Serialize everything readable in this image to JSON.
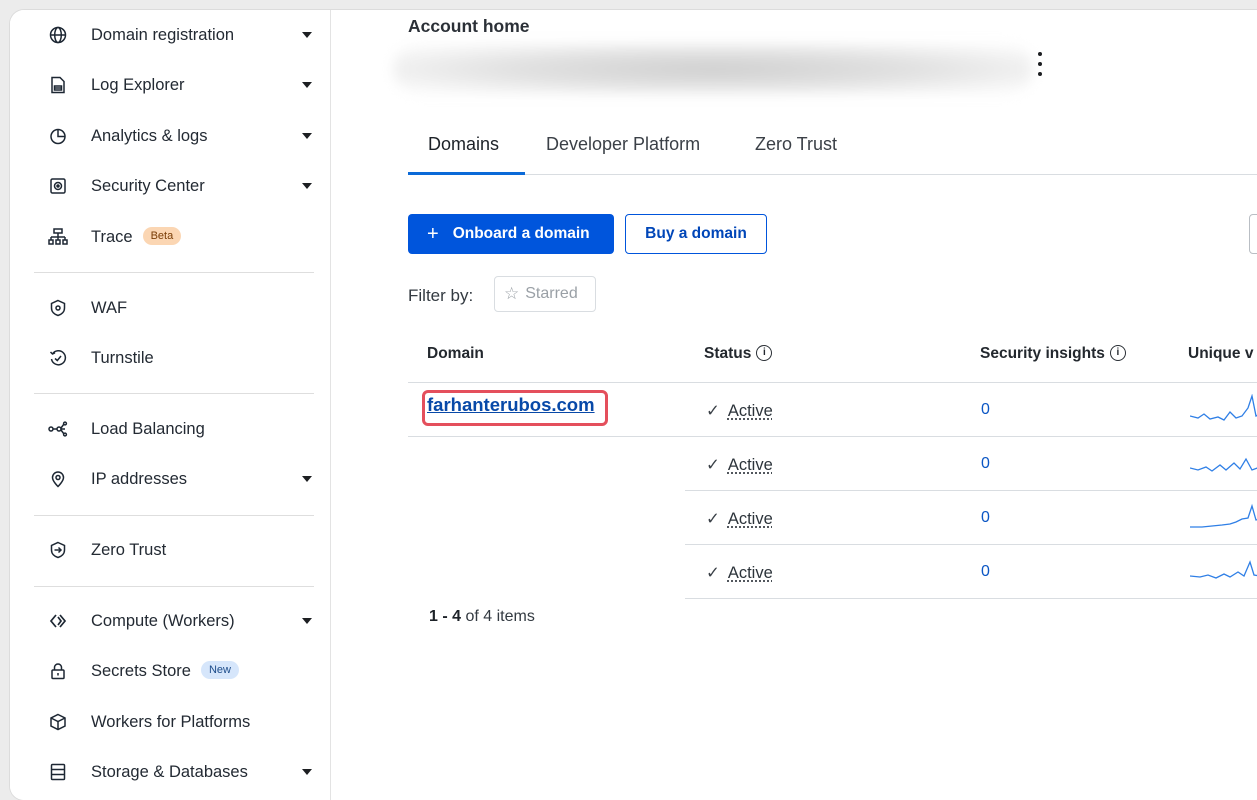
{
  "sidebar": {
    "items": [
      {
        "label": "Domain registration",
        "icon": "globe-icon",
        "caret": true
      },
      {
        "label": "Log Explorer",
        "icon": "log-document-icon",
        "caret": true
      },
      {
        "label": "Analytics & logs",
        "icon": "pie-chart-icon",
        "caret": true
      },
      {
        "label": "Security Center",
        "icon": "security-center-icon",
        "caret": true
      },
      {
        "label": "Trace",
        "icon": "trace-tree-icon",
        "badge": "Beta"
      },
      {
        "label": "WAF",
        "icon": "waf-shield-icon"
      },
      {
        "label": "Turnstile",
        "icon": "turnstile-icon"
      },
      {
        "label": "Load Balancing",
        "icon": "load-balancing-icon"
      },
      {
        "label": "IP addresses",
        "icon": "location-pin-icon",
        "caret": true
      },
      {
        "label": "Zero Trust",
        "icon": "zero-trust-icon"
      },
      {
        "label": "Compute (Workers)",
        "icon": "workers-icon",
        "caret": true
      },
      {
        "label": "Secrets Store",
        "icon": "lock-icon",
        "badge": "New"
      },
      {
        "label": "Workers for Platforms",
        "icon": "cube-icon"
      },
      {
        "label": "Storage & Databases",
        "icon": "database-icon",
        "caret": true
      }
    ]
  },
  "main": {
    "title": "Account home",
    "tabs": [
      {
        "label": "Domains",
        "active": true
      },
      {
        "label": "Developer Platform"
      },
      {
        "label": "Zero Trust"
      }
    ],
    "buttons": {
      "onboard": "Onboard a domain",
      "onboard_icon": "+",
      "buy": "Buy a domain"
    },
    "filter": {
      "label": "Filter by:",
      "starred": "Starred",
      "star_icon": "☆"
    },
    "table": {
      "headers": {
        "domain": "Domain",
        "status": "Status",
        "insights": "Security insights",
        "unique": "Unique v"
      },
      "rows": [
        {
          "domain": "farhanterubos.com",
          "status": "Active",
          "insights": "0"
        },
        {
          "domain": "",
          "status": "Active",
          "insights": "0"
        },
        {
          "domain": "",
          "status": "Active",
          "insights": "0"
        },
        {
          "domain": "",
          "status": "Active",
          "insights": "0"
        }
      ]
    },
    "pager": {
      "range": "1 - 4",
      "rest": " of 4 items"
    }
  },
  "colors": {
    "primary": "#0055dc",
    "link": "#0849a8",
    "highlight": "#e44f5c",
    "badge_beta": "#fbd6b3",
    "badge_new": "#d6e6fb"
  }
}
